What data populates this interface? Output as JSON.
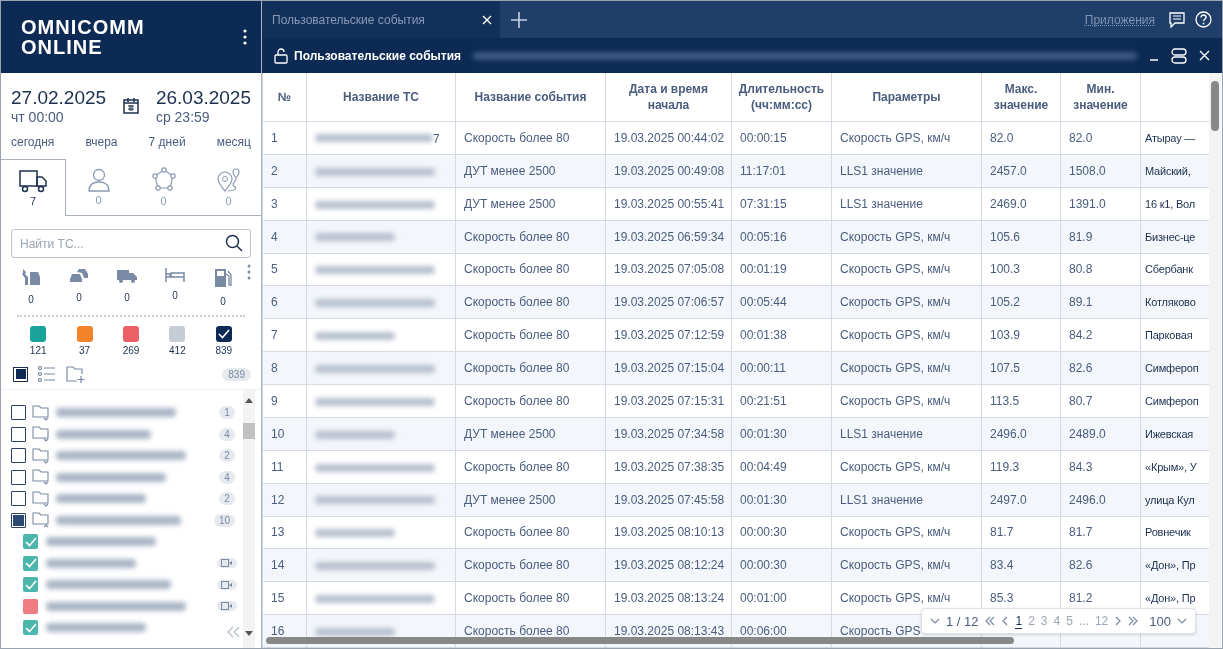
{
  "logo": {
    "line1": "OMNICOMM",
    "line2": "ONLINE"
  },
  "period": {
    "from_date": "27.02.2025",
    "from_time": "чт 00:00",
    "to_date": "26.03.2025",
    "to_time": "ср 23:59"
  },
  "quick_ranges": [
    "сегодня",
    "вчера",
    "7 дней",
    "месяц"
  ],
  "object_tabs": [
    {
      "kind": "truck",
      "count": "7",
      "selected": true
    },
    {
      "kind": "person",
      "count": "0",
      "selected": false
    },
    {
      "kind": "network",
      "count": "0",
      "selected": false
    },
    {
      "kind": "route",
      "count": "0",
      "selected": false
    }
  ],
  "search": {
    "placeholder": "Найти ТС..."
  },
  "categories": [
    {
      "kind": "repair",
      "count": "0"
    },
    {
      "kind": "crash",
      "count": "0"
    },
    {
      "kind": "truck",
      "count": "0"
    },
    {
      "kind": "bed",
      "count": "0"
    },
    {
      "kind": "fuel",
      "count": "0"
    }
  ],
  "status_filters": [
    {
      "color": "#1aa39a",
      "count": "121",
      "checked": false
    },
    {
      "color": "#f5832a",
      "count": "37",
      "checked": false
    },
    {
      "color": "#ec5f67",
      "count": "269",
      "checked": false
    },
    {
      "color": "#c5ccd4",
      "count": "412",
      "checked": false
    },
    {
      "color": "#0d2a54",
      "count": "839",
      "checked": true
    }
  ],
  "tree_total": "839",
  "select_all": {
    "checked": true
  },
  "groups": [
    {
      "count": "1",
      "checked": false,
      "expanded": false
    },
    {
      "count": "4",
      "checked": false,
      "expanded": false
    },
    {
      "count": "2",
      "checked": false,
      "expanded": false
    },
    {
      "count": "4",
      "checked": false,
      "expanded": false
    },
    {
      "count": "2",
      "checked": false,
      "expanded": false
    },
    {
      "count": "10",
      "checked": true,
      "expanded": true,
      "children": [
        {
          "color": "#4db6ac",
          "checked": true,
          "camera": false
        },
        {
          "color": "#4db6ac",
          "checked": true,
          "camera": true
        },
        {
          "color": "#4db6ac",
          "checked": true,
          "camera": true
        },
        {
          "color": "#f07c82",
          "checked": false,
          "camera": true
        },
        {
          "color": "#4db6ac",
          "checked": true,
          "camera": false
        }
      ]
    }
  ],
  "tabs": [
    {
      "label": "Пользовательские события",
      "selected": true
    }
  ],
  "header_links": {
    "apps": "Приложения"
  },
  "panel": {
    "title": "Пользовательские события"
  },
  "table": {
    "columns": [
      "№",
      "Название ТС",
      "Название события",
      "Дата и время начала",
      "Длительность (чч:мм:сс)",
      "Параметры",
      "Макс. значение",
      "Мин. значение"
    ],
    "rows": [
      {
        "n": "1",
        "vehicle_tail": "7",
        "event": "Скорость более 80",
        "start": "19.03.2025 00:44:02",
        "duration": "00:00:15",
        "param": "Скорость GPS, км/ч",
        "max": "82.0",
        "min": "82.0",
        "address": "Атырау —"
      },
      {
        "n": "2",
        "event": "ДУТ менее 2500",
        "start": "19.03.2025 00:49:08",
        "duration": "11:17:01",
        "param": "LLS1 значение",
        "max": "2457.0",
        "min": "1508.0",
        "address": "Майский,"
      },
      {
        "n": "3",
        "event": "ДУТ менее 2500",
        "start": "19.03.2025 00:55:41",
        "duration": "07:31:15",
        "param": "LLS1 значение",
        "max": "2469.0",
        "min": "1391.0",
        "address": "16 к1, Вол"
      },
      {
        "n": "4",
        "event": "Скорость более 80",
        "start": "19.03.2025 06:59:34",
        "duration": "00:05:16",
        "param": "Скорость GPS, км/ч",
        "max": "105.6",
        "min": "81.9",
        "address": "Бизнес-це"
      },
      {
        "n": "5",
        "event": "Скорость более 80",
        "start": "19.03.2025 07:05:08",
        "duration": "00:01:19",
        "param": "Скорость GPS, км/ч",
        "max": "100.3",
        "min": "80.8",
        "address": "Сбербанк"
      },
      {
        "n": "6",
        "event": "Скорость более 80",
        "start": "19.03.2025 07:06:57",
        "duration": "00:05:44",
        "param": "Скорость GPS, км/ч",
        "max": "105.2",
        "min": "89.1",
        "address": "Котляково"
      },
      {
        "n": "7",
        "event": "Скорость более 80",
        "start": "19.03.2025 07:12:59",
        "duration": "00:01:38",
        "param": "Скорость GPS, км/ч",
        "max": "103.9",
        "min": "84.2",
        "address": "Парковая"
      },
      {
        "n": "8",
        "event": "Скорость более 80",
        "start": "19.03.2025 07:15:04",
        "duration": "00:00:11",
        "param": "Скорость GPS, км/ч",
        "max": "107.5",
        "min": "82.6",
        "address": "Симфероп"
      },
      {
        "n": "9",
        "event": "Скорость более 80",
        "start": "19.03.2025 07:15:31",
        "duration": "00:21:51",
        "param": "Скорость GPS, км/ч",
        "max": "113.5",
        "min": "80.7",
        "address": "Симфероп"
      },
      {
        "n": "10",
        "event": "ДУТ менее 2500",
        "start": "19.03.2025 07:34:58",
        "duration": "00:01:30",
        "param": "LLS1 значение",
        "max": "2496.0",
        "min": "2489.0",
        "address": "Ижевская"
      },
      {
        "n": "11",
        "event": "Скорость более 80",
        "start": "19.03.2025 07:38:35",
        "duration": "00:04:49",
        "param": "Скорость GPS, км/ч",
        "max": "119.3",
        "min": "84.3",
        "address": "«Крым», У"
      },
      {
        "n": "12",
        "event": "ДУТ менее 2500",
        "start": "19.03.2025 07:45:58",
        "duration": "00:01:30",
        "param": "LLS1 значение",
        "max": "2497.0",
        "min": "2496.0",
        "address": "улица Кул"
      },
      {
        "n": "13",
        "event": "Скорость более 80",
        "start": "19.03.2025 08:10:13",
        "duration": "00:00:30",
        "param": "Скорость GPS, км/ч",
        "max": "81.7",
        "min": "81.7",
        "address": "Ровнечик"
      },
      {
        "n": "14",
        "event": "Скорость более 80",
        "start": "19.03.2025 08:12:24",
        "duration": "00:00:30",
        "param": "Скорость GPS, км/ч",
        "max": "83.4",
        "min": "82.6",
        "address": "«Дон», Пр"
      },
      {
        "n": "15",
        "event": "Скорость более 80",
        "start": "19.03.2025 08:13:24",
        "duration": "00:01:00",
        "param": "Скорость GPS, км/ч",
        "max": "85.3",
        "min": "81.2",
        "address": "«Дон», Пр"
      },
      {
        "n": "16",
        "event": "Скорость более 80",
        "start": "19.03.2025 08:13:43",
        "duration": "00:06:00",
        "param": "Скорость GPS"
      }
    ]
  },
  "pager": {
    "page": "1 / 12",
    "pages": [
      {
        "label": "1",
        "selected": true
      },
      {
        "label": "2",
        "selected": false
      },
      {
        "label": "3",
        "selected": false
      },
      {
        "label": "4",
        "selected": false
      },
      {
        "label": "5",
        "selected": false
      },
      {
        "label": "...",
        "selected": false
      },
      {
        "label": "12",
        "selected": false
      }
    ],
    "page_size": "100"
  }
}
